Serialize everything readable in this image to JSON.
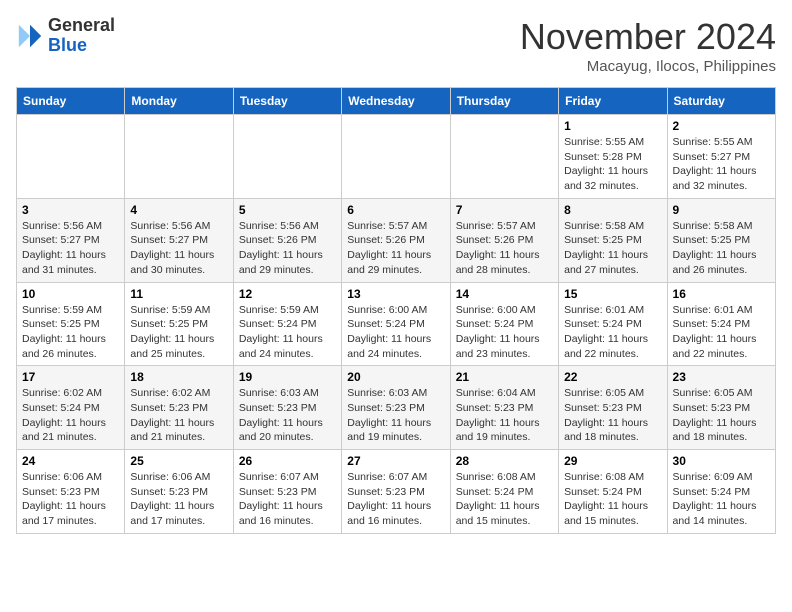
{
  "header": {
    "logo": {
      "general": "General",
      "blue": "Blue"
    },
    "title": "November 2024",
    "location": "Macayug, Ilocos, Philippines"
  },
  "weekdays": [
    "Sunday",
    "Monday",
    "Tuesday",
    "Wednesday",
    "Thursday",
    "Friday",
    "Saturday"
  ],
  "weeks": [
    [
      null,
      null,
      null,
      null,
      null,
      {
        "day": "1",
        "sunrise": "Sunrise: 5:55 AM",
        "sunset": "Sunset: 5:28 PM",
        "daylight": "Daylight: 11 hours and 32 minutes."
      },
      {
        "day": "2",
        "sunrise": "Sunrise: 5:55 AM",
        "sunset": "Sunset: 5:27 PM",
        "daylight": "Daylight: 11 hours and 32 minutes."
      }
    ],
    [
      {
        "day": "3",
        "sunrise": "Sunrise: 5:56 AM",
        "sunset": "Sunset: 5:27 PM",
        "daylight": "Daylight: 11 hours and 31 minutes."
      },
      {
        "day": "4",
        "sunrise": "Sunrise: 5:56 AM",
        "sunset": "Sunset: 5:27 PM",
        "daylight": "Daylight: 11 hours and 30 minutes."
      },
      {
        "day": "5",
        "sunrise": "Sunrise: 5:56 AM",
        "sunset": "Sunset: 5:26 PM",
        "daylight": "Daylight: 11 hours and 29 minutes."
      },
      {
        "day": "6",
        "sunrise": "Sunrise: 5:57 AM",
        "sunset": "Sunset: 5:26 PM",
        "daylight": "Daylight: 11 hours and 29 minutes."
      },
      {
        "day": "7",
        "sunrise": "Sunrise: 5:57 AM",
        "sunset": "Sunset: 5:26 PM",
        "daylight": "Daylight: 11 hours and 28 minutes."
      },
      {
        "day": "8",
        "sunrise": "Sunrise: 5:58 AM",
        "sunset": "Sunset: 5:25 PM",
        "daylight": "Daylight: 11 hours and 27 minutes."
      },
      {
        "day": "9",
        "sunrise": "Sunrise: 5:58 AM",
        "sunset": "Sunset: 5:25 PM",
        "daylight": "Daylight: 11 hours and 26 minutes."
      }
    ],
    [
      {
        "day": "10",
        "sunrise": "Sunrise: 5:59 AM",
        "sunset": "Sunset: 5:25 PM",
        "daylight": "Daylight: 11 hours and 26 minutes."
      },
      {
        "day": "11",
        "sunrise": "Sunrise: 5:59 AM",
        "sunset": "Sunset: 5:25 PM",
        "daylight": "Daylight: 11 hours and 25 minutes."
      },
      {
        "day": "12",
        "sunrise": "Sunrise: 5:59 AM",
        "sunset": "Sunset: 5:24 PM",
        "daylight": "Daylight: 11 hours and 24 minutes."
      },
      {
        "day": "13",
        "sunrise": "Sunrise: 6:00 AM",
        "sunset": "Sunset: 5:24 PM",
        "daylight": "Daylight: 11 hours and 24 minutes."
      },
      {
        "day": "14",
        "sunrise": "Sunrise: 6:00 AM",
        "sunset": "Sunset: 5:24 PM",
        "daylight": "Daylight: 11 hours and 23 minutes."
      },
      {
        "day": "15",
        "sunrise": "Sunrise: 6:01 AM",
        "sunset": "Sunset: 5:24 PM",
        "daylight": "Daylight: 11 hours and 22 minutes."
      },
      {
        "day": "16",
        "sunrise": "Sunrise: 6:01 AM",
        "sunset": "Sunset: 5:24 PM",
        "daylight": "Daylight: 11 hours and 22 minutes."
      }
    ],
    [
      {
        "day": "17",
        "sunrise": "Sunrise: 6:02 AM",
        "sunset": "Sunset: 5:24 PM",
        "daylight": "Daylight: 11 hours and 21 minutes."
      },
      {
        "day": "18",
        "sunrise": "Sunrise: 6:02 AM",
        "sunset": "Sunset: 5:23 PM",
        "daylight": "Daylight: 11 hours and 21 minutes."
      },
      {
        "day": "19",
        "sunrise": "Sunrise: 6:03 AM",
        "sunset": "Sunset: 5:23 PM",
        "daylight": "Daylight: 11 hours and 20 minutes."
      },
      {
        "day": "20",
        "sunrise": "Sunrise: 6:03 AM",
        "sunset": "Sunset: 5:23 PM",
        "daylight": "Daylight: 11 hours and 19 minutes."
      },
      {
        "day": "21",
        "sunrise": "Sunrise: 6:04 AM",
        "sunset": "Sunset: 5:23 PM",
        "daylight": "Daylight: 11 hours and 19 minutes."
      },
      {
        "day": "22",
        "sunrise": "Sunrise: 6:05 AM",
        "sunset": "Sunset: 5:23 PM",
        "daylight": "Daylight: 11 hours and 18 minutes."
      },
      {
        "day": "23",
        "sunrise": "Sunrise: 6:05 AM",
        "sunset": "Sunset: 5:23 PM",
        "daylight": "Daylight: 11 hours and 18 minutes."
      }
    ],
    [
      {
        "day": "24",
        "sunrise": "Sunrise: 6:06 AM",
        "sunset": "Sunset: 5:23 PM",
        "daylight": "Daylight: 11 hours and 17 minutes."
      },
      {
        "day": "25",
        "sunrise": "Sunrise: 6:06 AM",
        "sunset": "Sunset: 5:23 PM",
        "daylight": "Daylight: 11 hours and 17 minutes."
      },
      {
        "day": "26",
        "sunrise": "Sunrise: 6:07 AM",
        "sunset": "Sunset: 5:23 PM",
        "daylight": "Daylight: 11 hours and 16 minutes."
      },
      {
        "day": "27",
        "sunrise": "Sunrise: 6:07 AM",
        "sunset": "Sunset: 5:23 PM",
        "daylight": "Daylight: 11 hours and 16 minutes."
      },
      {
        "day": "28",
        "sunrise": "Sunrise: 6:08 AM",
        "sunset": "Sunset: 5:24 PM",
        "daylight": "Daylight: 11 hours and 15 minutes."
      },
      {
        "day": "29",
        "sunrise": "Sunrise: 6:08 AM",
        "sunset": "Sunset: 5:24 PM",
        "daylight": "Daylight: 11 hours and 15 minutes."
      },
      {
        "day": "30",
        "sunrise": "Sunrise: 6:09 AM",
        "sunset": "Sunset: 5:24 PM",
        "daylight": "Daylight: 11 hours and 14 minutes."
      }
    ]
  ]
}
